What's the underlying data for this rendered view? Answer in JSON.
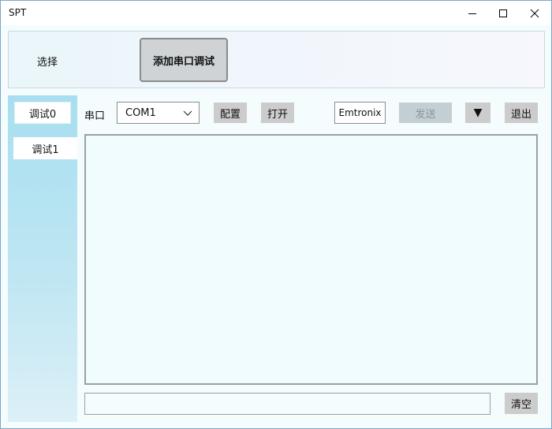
{
  "window": {
    "title": "SPT"
  },
  "top": {
    "select_label": "选择",
    "add_button": "添加串口调试"
  },
  "tabs": [
    {
      "label": "调试0"
    },
    {
      "label": "调试1"
    }
  ],
  "toolbar": {
    "port_label": "串口",
    "port_value": "COM1",
    "config_button": "配置",
    "open_button": "打开",
    "text_value": "Emtronix",
    "send_button": "发送",
    "dropdown_button": "▼",
    "exit_button": "退出"
  },
  "bottom": {
    "input_value": "",
    "clear_button": "清空"
  },
  "icons": {
    "minimize": "minimize-icon",
    "maximize": "maximize-icon",
    "close": "close-icon",
    "combo_chevron": "chevron-down-icon"
  }
}
